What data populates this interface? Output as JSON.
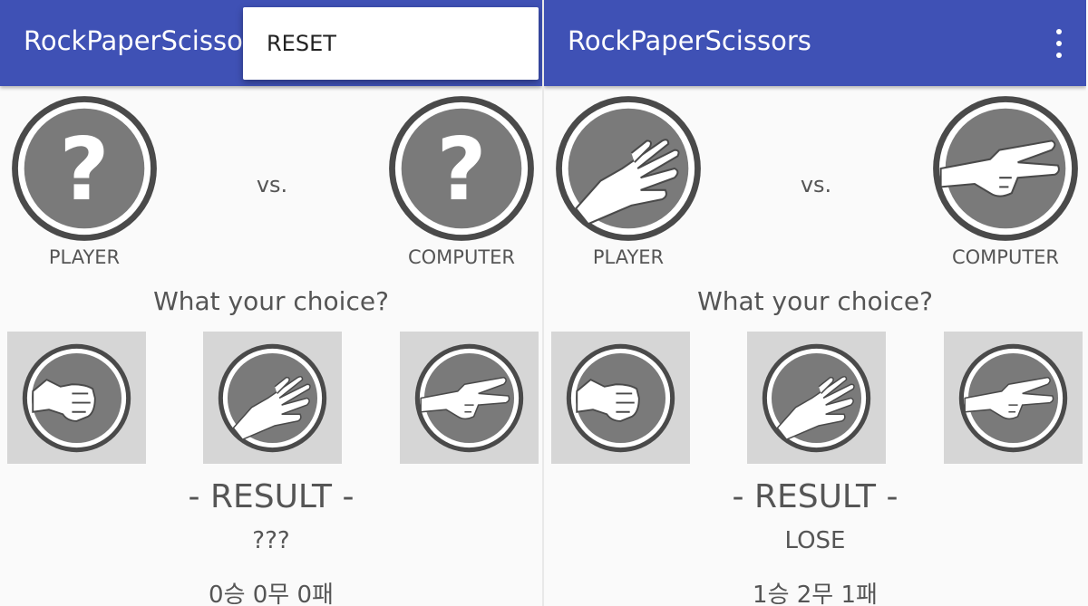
{
  "screens": [
    {
      "app_title": "RockPaperScissors",
      "menu_popup": {
        "reset_label": "RESET"
      },
      "player": {
        "label": "PLAYER",
        "icon": "question-icon"
      },
      "computer": {
        "label": "COMPUTER",
        "icon": "question-icon"
      },
      "vs_label": "vs.",
      "prompt": "What your choice?",
      "choices": [
        {
          "icon": "rock-fist-icon"
        },
        {
          "icon": "paper-hand-icon"
        },
        {
          "icon": "scissors-hand-icon"
        }
      ],
      "result_title": "- RESULT -",
      "result_value": "???",
      "score": "0승 0무 0패"
    },
    {
      "app_title": "RockPaperScissors",
      "overflow_icon": "more-vert-icon",
      "player": {
        "label": "PLAYER",
        "icon": "paper-hand-icon"
      },
      "computer": {
        "label": "COMPUTER",
        "icon": "scissors-hand-icon"
      },
      "vs_label": "vs.",
      "prompt": "What your choice?",
      "choices": [
        {
          "icon": "rock-fist-icon"
        },
        {
          "icon": "paper-hand-icon"
        },
        {
          "icon": "scissors-hand-icon"
        }
      ],
      "result_title": "- RESULT -",
      "result_value": "LOSE",
      "score": "1승 2무 1패"
    }
  ],
  "colors": {
    "app_bar": "#3f51b5",
    "circle_fill": "#7a7a7a",
    "circle_stroke": "#4a4a4a",
    "choice_bg": "#d6d6d6",
    "text": "#555555"
  }
}
